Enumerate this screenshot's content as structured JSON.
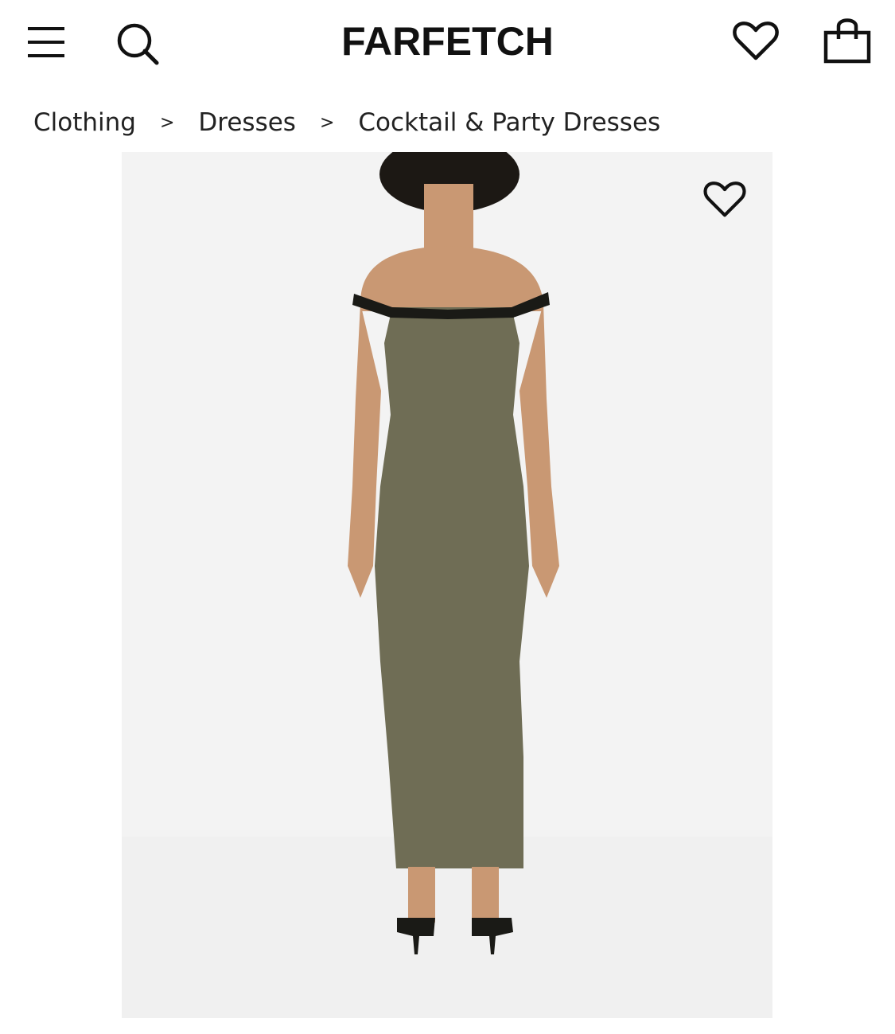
{
  "header": {
    "logo": "FARFETCH",
    "icons": {
      "menu": "hamburger-menu-icon",
      "search": "search-icon",
      "wishlist": "heart-icon",
      "bag": "shopping-bag-icon"
    }
  },
  "breadcrumb": {
    "items": [
      "Clothing",
      "Dresses",
      "Cocktail & Party Dresses"
    ],
    "separator": ">"
  },
  "product_image": {
    "alt_colors": {
      "dress": "#6f6d55",
      "trim": "#1a1a16",
      "skin": "#c99873",
      "hair": "#1c1814",
      "background": "#f3f3f3"
    },
    "wishlist_icon": "heart-icon"
  }
}
